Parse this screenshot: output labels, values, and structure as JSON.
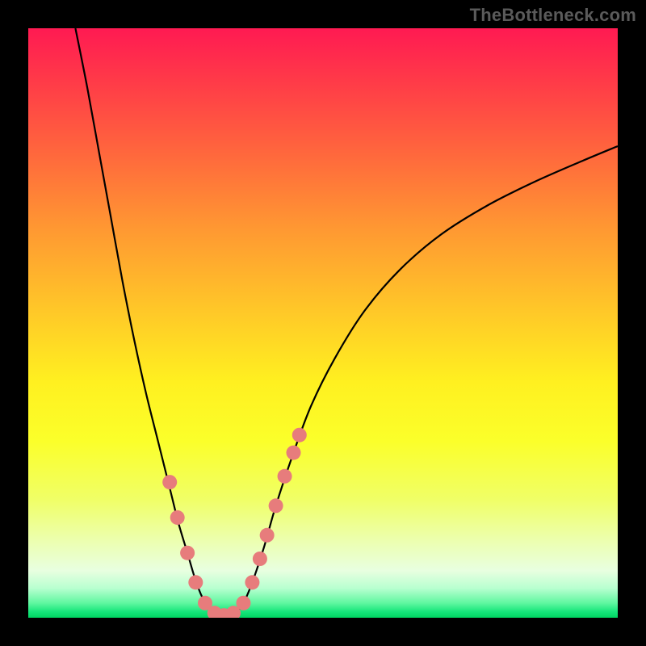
{
  "watermark": "TheBottleneck.com",
  "colors": {
    "gradient_top": "#ff1a52",
    "gradient_mid": "#fff020",
    "gradient_bottom": "#00d562",
    "curve": "#000000",
    "marker": "#e77c7c",
    "frame": "#000000"
  },
  "chart_data": {
    "type": "line",
    "title": "",
    "xlabel": "",
    "ylabel": "",
    "xlim": [
      0,
      100
    ],
    "ylim": [
      0,
      100
    ],
    "grid": false,
    "legend": false,
    "series": [
      {
        "name": "left-branch",
        "x": [
          8,
          10,
          12,
          14,
          16,
          18,
          20,
          22,
          24,
          25.5,
          27,
          28.5,
          30,
          31.5
        ],
        "y": [
          100,
          90,
          79,
          68,
          57,
          47,
          38,
          30,
          22,
          16,
          11,
          6,
          2.5,
          0.5
        ]
      },
      {
        "name": "right-branch",
        "x": [
          35,
          36.5,
          38,
          40,
          42,
          45,
          48,
          52,
          57,
          63,
          70,
          78,
          86,
          94,
          100
        ],
        "y": [
          0.5,
          2.5,
          6,
          12,
          19,
          28,
          36,
          44,
          52,
          59,
          65,
          70,
          74,
          77.5,
          80
        ]
      },
      {
        "name": "valley-floor",
        "x": [
          31.5,
          33.2,
          35
        ],
        "y": [
          0.5,
          0.2,
          0.5
        ]
      }
    ],
    "markers": {
      "name": "highlight-dots",
      "points": [
        {
          "x": 24.0,
          "y": 23.0
        },
        {
          "x": 25.3,
          "y": 17.0
        },
        {
          "x": 27.0,
          "y": 11.0
        },
        {
          "x": 28.4,
          "y": 6.0
        },
        {
          "x": 30.0,
          "y": 2.5
        },
        {
          "x": 31.6,
          "y": 0.8
        },
        {
          "x": 33.2,
          "y": 0.4
        },
        {
          "x": 34.8,
          "y": 0.8
        },
        {
          "x": 36.5,
          "y": 2.5
        },
        {
          "x": 38.0,
          "y": 6.0
        },
        {
          "x": 39.3,
          "y": 10.0
        },
        {
          "x": 40.5,
          "y": 14.0
        },
        {
          "x": 42.0,
          "y": 19.0
        },
        {
          "x": 43.5,
          "y": 24.0
        },
        {
          "x": 45.0,
          "y": 28.0
        },
        {
          "x": 46.0,
          "y": 31.0
        }
      ],
      "radius": 9
    }
  }
}
